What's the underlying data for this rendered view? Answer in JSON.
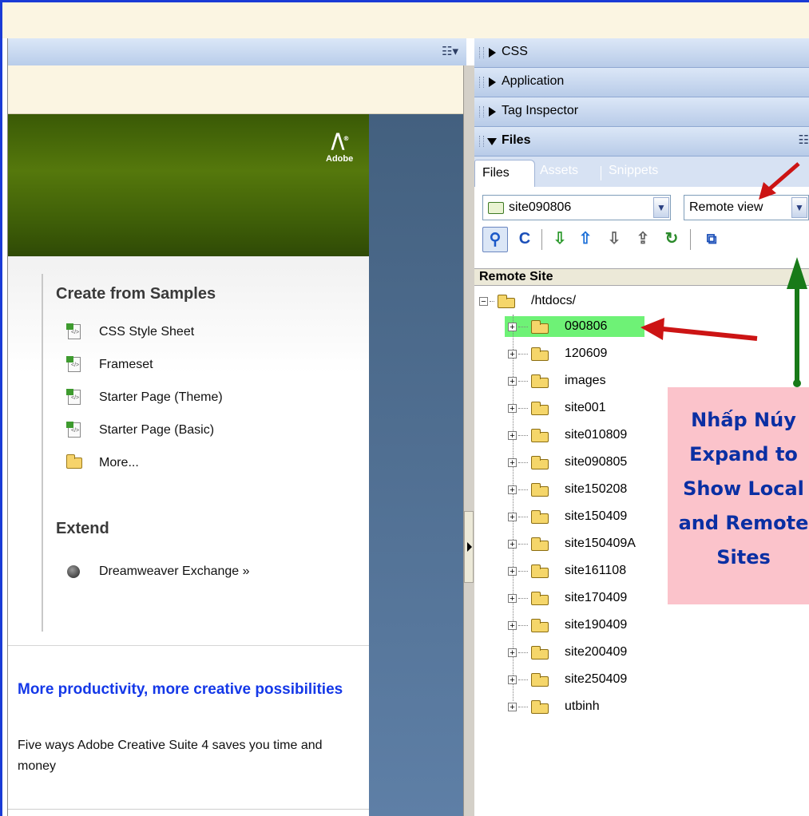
{
  "left_panel": {
    "brand": "Adobe",
    "create_section": {
      "title": "Create from Samples",
      "items": [
        "CSS Style Sheet",
        "Frameset",
        "Starter Page (Theme)",
        "Starter Page (Basic)",
        "More..."
      ]
    },
    "extend_section": {
      "title": "Extend",
      "items": [
        "Dreamweaver Exchange »"
      ]
    },
    "promo": {
      "title": "More productivity, more creative possibilities",
      "description": "Five ways Adobe Creative Suite 4 saves you time and money"
    }
  },
  "panels": {
    "collapsed": [
      "CSS",
      "Application",
      "Tag Inspector"
    ],
    "files": {
      "title": "Files",
      "tabs": [
        "Files",
        "Assets",
        "Snippets"
      ],
      "site_select": "site090806",
      "view_select": "Remote view",
      "tree_header": "Remote Site",
      "root": "/htdocs/",
      "folders": [
        "090806",
        "120609",
        "images",
        "site001",
        "site010809",
        "site090805",
        "site150208",
        "site150409",
        "site150409A",
        "site161108",
        "site170409",
        "site190409",
        "site200409",
        "site250409",
        "utbinh"
      ],
      "selected_folder": "090806"
    }
  },
  "annotation": {
    "text_lines": [
      "Nhấp Núy",
      "Expand to",
      "Show Local",
      "and Remote",
      "Sites"
    ],
    "colors": {
      "note_bg": "#fbc3cb",
      "note_text": "#0a2fa3",
      "red_arrow": "#cc1414",
      "green_arrow": "#187a18",
      "highlight": "#6ef276"
    }
  }
}
